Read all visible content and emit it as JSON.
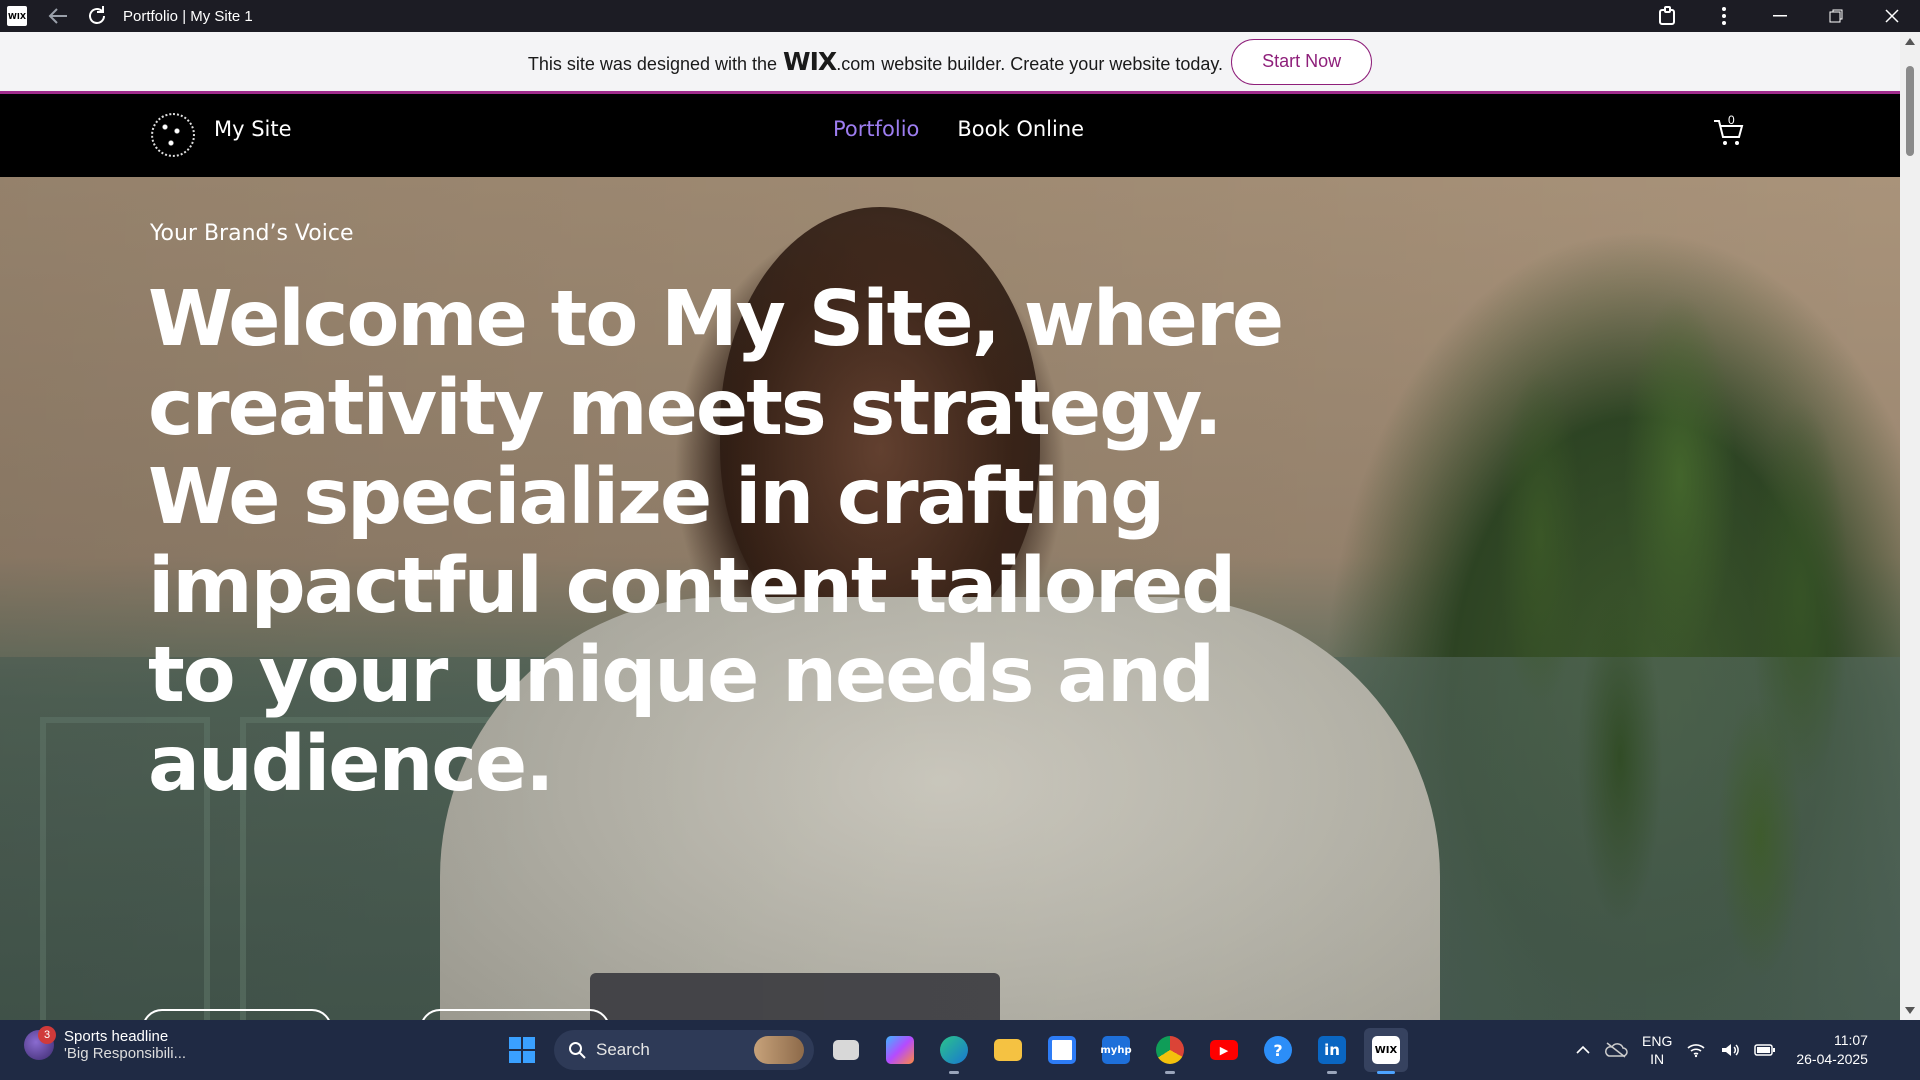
{
  "window": {
    "title": "Portfolio | My Site 1",
    "logo_text": "WIX"
  },
  "banner": {
    "text_before": "This site was designed with the",
    "wix_word": "WIX",
    "wix_dotcom": ".com",
    "text_after": "website builder. Create your website today.",
    "cta_label": "Start Now",
    "accent_color": "#a02c8c"
  },
  "site": {
    "name": "My Site",
    "nav": [
      {
        "label": "Portfolio",
        "active": true
      },
      {
        "label": "Book Online",
        "active": false
      }
    ],
    "cart_count": "0",
    "active_nav_color": "#9d7df0"
  },
  "hero": {
    "eyebrow": "Your Brand’s Voice",
    "headline": "Welcome to My Site, where creativity meets strategy. We specialize in crafting impactful content tailored to your unique needs and audience."
  },
  "taskbar": {
    "news_badge": "3",
    "news_title": "Sports headline",
    "news_subtitle": "'Big Responsibili...",
    "search_placeholder": "Search",
    "apps": [
      {
        "name": "task-view-icon",
        "glyph": ""
      },
      {
        "name": "copilot-icon",
        "glyph": ""
      },
      {
        "name": "edge-icon",
        "glyph": ""
      },
      {
        "name": "file-explorer-icon",
        "glyph": ""
      },
      {
        "name": "microsoft-store-icon",
        "glyph": ""
      },
      {
        "name": "myhp-icon",
        "glyph": "myhp"
      },
      {
        "name": "chrome-icon",
        "glyph": ""
      },
      {
        "name": "youtube-icon",
        "glyph": "▶"
      },
      {
        "name": "help-icon",
        "glyph": "?"
      },
      {
        "name": "linkedin-icon",
        "glyph": "in"
      },
      {
        "name": "wix-app-icon",
        "glyph": "WIX"
      }
    ],
    "language": "ENG",
    "region": "IN",
    "time": "11:07",
    "date": "26-04-2025"
  }
}
